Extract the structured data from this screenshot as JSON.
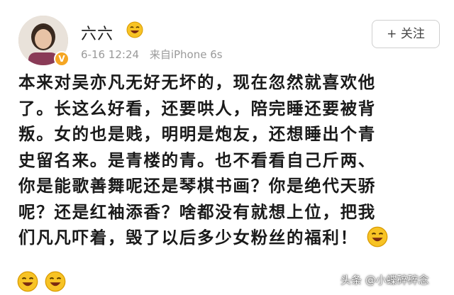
{
  "author": {
    "name": "六六",
    "verified": true
  },
  "post": {
    "timestamp": "6-16 12:24",
    "source": "来自iPhone 6s",
    "lines": [
      "本来对吴亦凡无好无坏的，现在忽然就喜欢他",
      "了。长这么好看，还要哄人，陪完睡还要被背",
      "叛。女的也是贱，明明是炮友，还想睡出个青",
      "史留名来。是青楼的青。也不看看自己斤两、",
      "你是能歌善舞呢还是琴棋书画？你是绝代天骄",
      "呢？还是红袖添香？啥都没有就想上位，把我",
      "们凡凡吓着，毁了以后多少女粉丝的福利！"
    ]
  },
  "follow_button": {
    "label": "+ 关注"
  },
  "watermark": "头条 @小蝶碎碎念",
  "icons": {
    "name_emoji": "laughing-emoji-icon",
    "inline_emoji": "laughing-emoji-icon",
    "verified_badge": "verified-v-badge-icon"
  }
}
